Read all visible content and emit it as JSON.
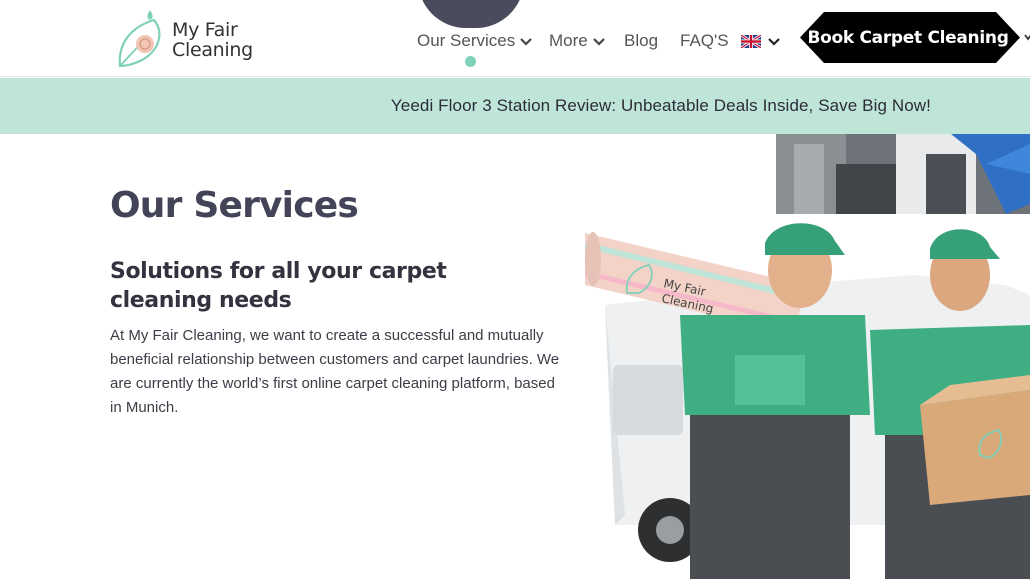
{
  "header": {
    "logo": {
      "line1": "My Fair",
      "line2": "Cleaning"
    },
    "nav": [
      {
        "label": "Our Services",
        "has_dropdown": true,
        "active": true
      },
      {
        "label": "More",
        "has_dropdown": true
      },
      {
        "label": "Blog"
      },
      {
        "label": "FAQ'S"
      }
    ],
    "language_icon": "uk-flag-icon",
    "cta_label": "Book Carpet Cleaning"
  },
  "banner": {
    "text": "Yeedi Floor 3 Station Review: Unbeatable Deals Inside, Save Big Now!"
  },
  "main": {
    "title": "Our Services",
    "subtitle": "Solutions for all your carpet cleaning needs",
    "body": "At My Fair Cleaning, we want to create a successful and mutually beneficial relationship between customers and carpet laundries. We are currently the world’s first online carpet cleaning platform, based in Munich."
  },
  "hero_image": {
    "carpet_logo_line1": "My Fair",
    "carpet_logo_line2": "Cleaning"
  },
  "colors": {
    "accent": "#7fd1b9",
    "banner": "#bfe5d9",
    "dark": "#4b4b5e",
    "cta": "#000000"
  }
}
